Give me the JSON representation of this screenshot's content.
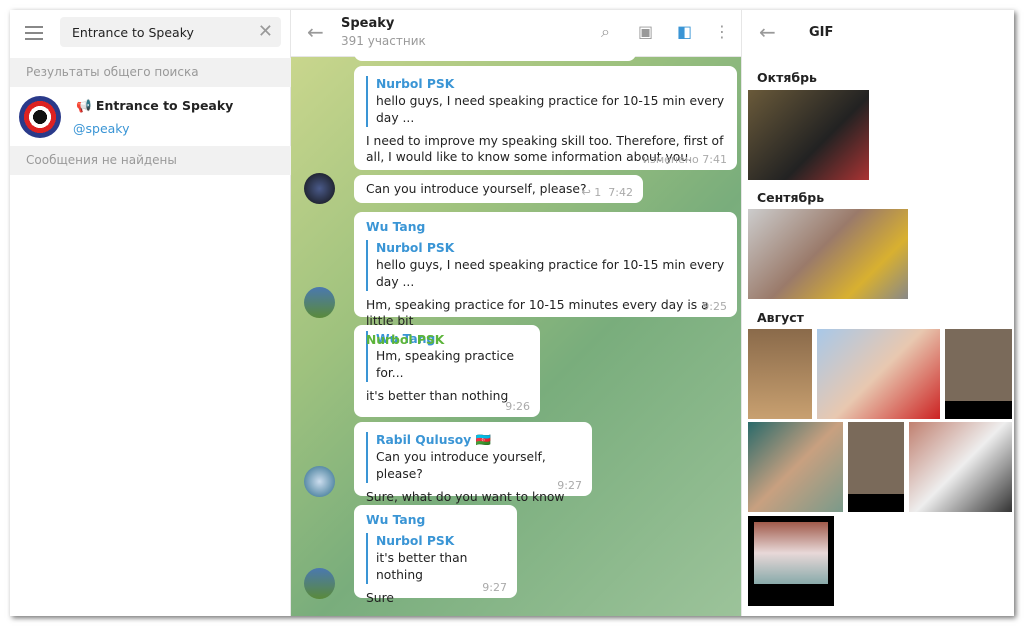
{
  "left": {
    "search_value": "Entrance to Speaky",
    "global_results_label": "Результаты общего поиска",
    "result": {
      "title": "Entrance to Speaky",
      "username": "@speaky",
      "icon": "megaphone-icon"
    },
    "no_messages_label": "Сообщения не найдены"
  },
  "chat": {
    "title": "Speaky",
    "subtitle": "391 участник",
    "messages": [
      {
        "reply_name": "Nurbol PSK",
        "reply_text": "hello guys, I need speaking practice for 10-15 min every day ...",
        "text": "I need to improve my speaking skill too. Therefore, first of all, I would like to know some information about you.",
        "time": "изменено 7:41"
      },
      {
        "text": "Can you introduce yourself, please?",
        "replies": "1",
        "time": "7:42"
      },
      {
        "sender": "Wu Tang",
        "reply_name": "Nurbol PSK",
        "reply_text": "hello guys, I need speaking practice for 10-15 min every day ...",
        "text": "Hm, speaking practice for 10-15 minutes every day is a little bit",
        "time": "9:25"
      },
      {
        "sender": "Nurbol PSK",
        "reply_name": "Wu Tang",
        "reply_text": "Hm, speaking practice for...",
        "text": "it's better than nothing",
        "time": "9:26"
      },
      {
        "reply_name": "Rabil Qulusoy 🇦🇿",
        "reply_text": "Can you introduce yourself, please?",
        "text": "Sure, what do you want to know",
        "time": "9:27"
      },
      {
        "sender": "Wu Tang",
        "reply_name": "Nurbol PSK",
        "reply_text": "it's better than nothing",
        "text": "Sure",
        "time": "9:27"
      }
    ],
    "colors": {
      "link": "#3a95d5",
      "green_sender": "#5cb43a"
    }
  },
  "gif_panel": {
    "title": "GIF",
    "months": [
      "Октябрь",
      "Сентябрь",
      "Август"
    ]
  }
}
